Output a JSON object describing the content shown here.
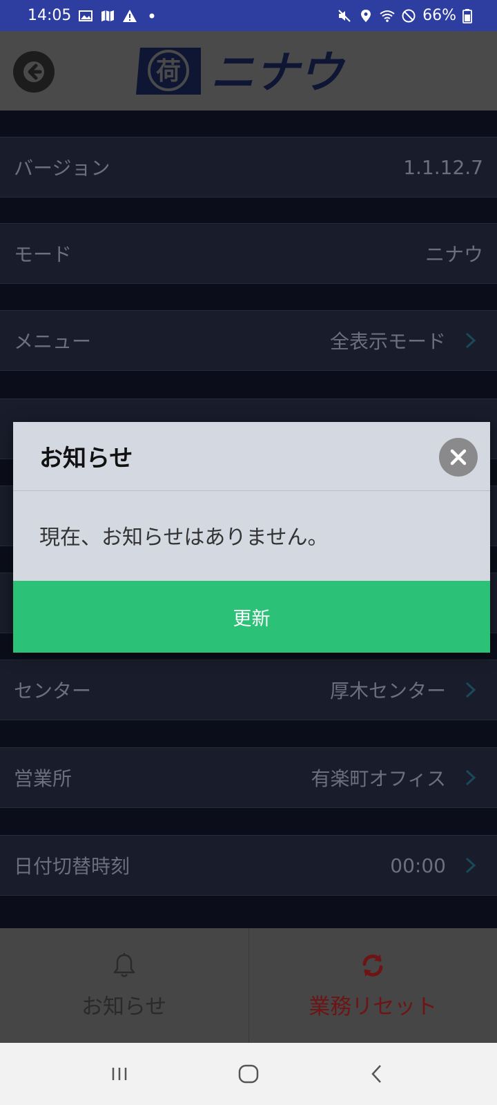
{
  "status_bar": {
    "time": "14:05",
    "battery": "66%"
  },
  "header": {
    "logo_seal_char": "荷",
    "logo_text": "ニナウ"
  },
  "settings": {
    "rows": [
      {
        "label": "バージョン",
        "value": "1.1.12.7",
        "chevron": false
      },
      {
        "label": "モード",
        "value": "ニナウ",
        "chevron": false
      },
      {
        "label": "メニュー",
        "value": "全表示モード",
        "chevron": true
      },
      {
        "label": "センター",
        "value": "厚木センター",
        "chevron": true
      },
      {
        "label": "営業所",
        "value": "有楽町オフィス",
        "chevron": true
      },
      {
        "label": "日付切替時刻",
        "value": "00:00",
        "chevron": true
      }
    ]
  },
  "tabbar": {
    "notice_label": "お知らせ",
    "reset_label": "業務リセット"
  },
  "dialog": {
    "title": "お知らせ",
    "message": "現在、お知らせはありません。",
    "refresh_label": "更新"
  },
  "colors": {
    "status_bar": "#2e3ea0",
    "accent_green": "#2bc277",
    "reset_red": "#6e1414",
    "chevron_teal": "#1a4a5a"
  },
  "icons": {
    "back": "arrow-left-icon",
    "close": "close-icon",
    "bell": "bell-icon",
    "sync": "sync-icon"
  }
}
